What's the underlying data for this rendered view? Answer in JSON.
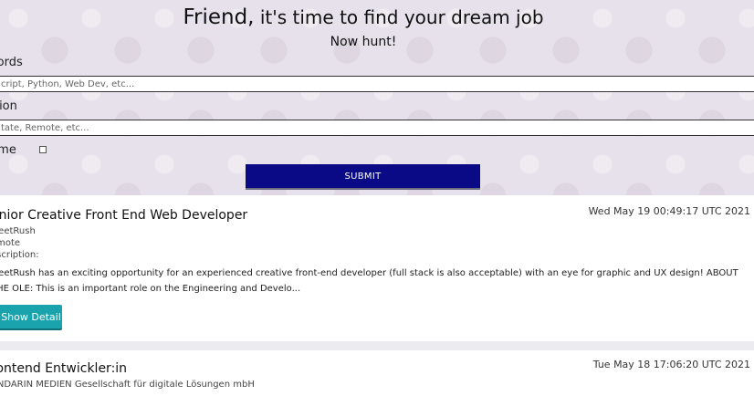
{
  "header": {
    "title_strong": "Friend,",
    "title_rest": " it's time to find your dream job",
    "subtitle": "Now hunt!"
  },
  "form": {
    "keywords_label": "words",
    "keywords_placeholder": "cript, Python, Web Dev, etc...",
    "location_label": "ation",
    "location_placeholder": "tate, Remote, etc...",
    "fulltime_label": "Time",
    "fulltime_checked": false,
    "submit_label": "SUBMIT"
  },
  "jobs": [
    {
      "title": "enior Creative Front End Web Developer",
      "date": "Wed May 19 00:49:17 UTC 2021",
      "company": "weetRush",
      "location": "emote",
      "description_label": "escription:",
      "description": "weetRush has an exciting opportunity for an experienced creative front-end developer (full stack is also acceptable) with an eye for graphic and UX design! ABOUT THE OLE: This is an important role on the Engineering and Develo...",
      "detail_button": "Show Detail"
    },
    {
      "title": "rontend Entwickler:in",
      "date": "Tue May 18 17:06:20 UTC 2021",
      "company": "ANDARIN MEDIEN Gesellschaft für digitale Lösungen mbH"
    }
  ]
}
